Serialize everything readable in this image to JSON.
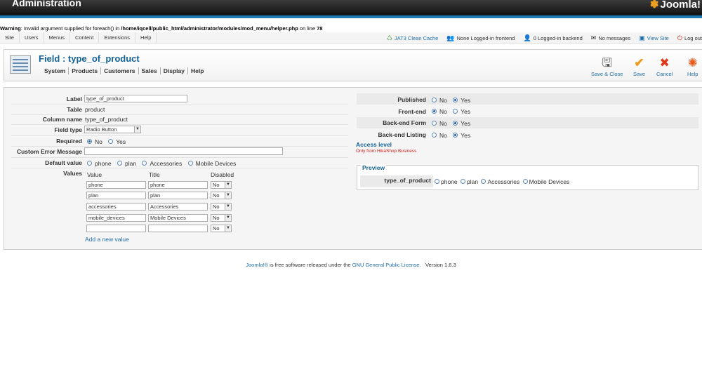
{
  "header": {
    "title": "Administration",
    "logo_text": "Joomla!",
    "warning_prefix": "Warning",
    "warning_mid": ": Invalid argument supplied for foreach() in ",
    "warning_path": "/home/iqcell/public_html/administrator/modules/mod_menu/helper.php",
    "warning_suffix": " on line ",
    "warning_line": "78"
  },
  "menu": [
    "Site",
    "Users",
    "Menus",
    "Content",
    "Extensions",
    "Help"
  ],
  "status": {
    "cache": "JAT3 Clean Cache",
    "frontend": "None Logged-in frontend",
    "backend": "0 Logged-in backend",
    "messages": "No messages",
    "view_site": "View Site",
    "logout": "Log out"
  },
  "toolbar": {
    "title": "Field : type_of_product",
    "submenu": [
      "System",
      "Products",
      "Customers",
      "Sales",
      "Display",
      "Help"
    ],
    "buttons": [
      "Save & Close",
      "Save",
      "Cancel",
      "Help"
    ]
  },
  "form": {
    "label_label": "Label",
    "label_value": "type_of_product",
    "table_label": "Table",
    "table_value": "product",
    "column_label": "Column name",
    "column_value": "type_of_product",
    "fieldtype_label": "Field type",
    "fieldtype_value": "Radio Button",
    "required_label": "Required",
    "required_no": "No",
    "required_yes": "Yes",
    "custom_error_label": "Custom Error Message",
    "custom_error_value": "",
    "default_label": "Default value",
    "default_options": [
      "phone",
      "plan",
      "Accessories",
      "Mobile Devices"
    ],
    "values_label": "Values",
    "col_value": "Value",
    "col_title": "Title",
    "col_disabled": "Disabled",
    "rows": [
      {
        "value": "phone",
        "title": "phone",
        "disabled": "No"
      },
      {
        "value": "plan",
        "title": "plan",
        "disabled": "No"
      },
      {
        "value": "accessories",
        "title": "Accessories",
        "disabled": "No"
      },
      {
        "value": "mobile_devices",
        "title": "Mobile Devices",
        "disabled": "No"
      },
      {
        "value": "",
        "title": "",
        "disabled": "No"
      }
    ],
    "add_value": "Add a new value"
  },
  "right": {
    "published_label": "Published",
    "frontend_label": "Front-end",
    "backend_form_label": "Back-end Form",
    "backend_listing_label": "Back-end Listing",
    "no": "No",
    "yes": "Yes",
    "access_level": "Access level",
    "access_note": "Only from HikaShop Business",
    "preview_legend": "Preview",
    "preview_label": "type_of_product",
    "preview_options": [
      "phone",
      "plan",
      "Accessories",
      "Mobile Devices"
    ]
  },
  "footer": {
    "joomla": "Joomla!®",
    "text": " is free software released under the ",
    "license": "GNU General Public License.",
    "version": "Version 1.6.3"
  }
}
